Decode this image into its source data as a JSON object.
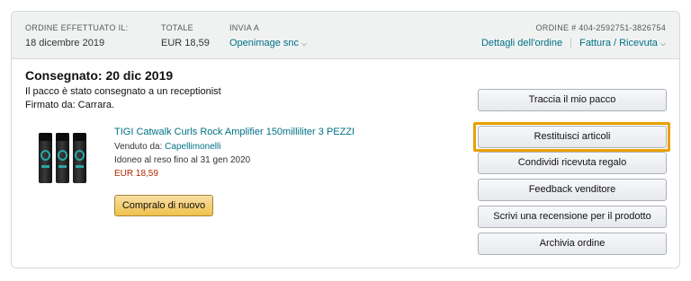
{
  "header": {
    "order_placed_label": "ORDINE EFFETTUATO IL:",
    "order_placed_value": "18 dicembre 2019",
    "total_label": "TOTALE",
    "total_value": "EUR 18,59",
    "ship_to_label": "INVIA A",
    "ship_to_value": "Openimage snc",
    "order_number": "ORDINE # 404-2592751-3826754",
    "order_details_link": "Dettagli dell'ordine",
    "invoice_link": "Fattura / Ricevuta"
  },
  "shipment": {
    "status_title": "Consegnato: 20 dic 2019",
    "status_detail": "Il pacco è stato consegnato a un receptionist",
    "signed_by": "Firmato da: Carrara."
  },
  "product": {
    "title": "TIGI Catwalk Curls Rock Amplifier 150milliliter 3 PEZZI",
    "sold_by_label": "Venduto da:",
    "seller": "Capellimonelli",
    "return_window": "Idoneo al reso fino al 31 gen 2020",
    "price": "EUR 18,59",
    "buy_again_label": "Compralo di nuovo"
  },
  "actions": {
    "track": "Traccia il mio pacco",
    "return": "Restituisci articoli",
    "share_gift_receipt": "Condividi ricevuta regalo",
    "seller_feedback": "Feedback venditore",
    "write_review": "Scrivi una recensione per il prodotto",
    "archive": "Archivia ordine"
  },
  "colors": {
    "link": "#007185",
    "price": "#b12704",
    "highlight": "#e8a200",
    "header_bg": "#f0f2f2"
  },
  "icons": {
    "dropdown": "chevron-down-icon"
  }
}
